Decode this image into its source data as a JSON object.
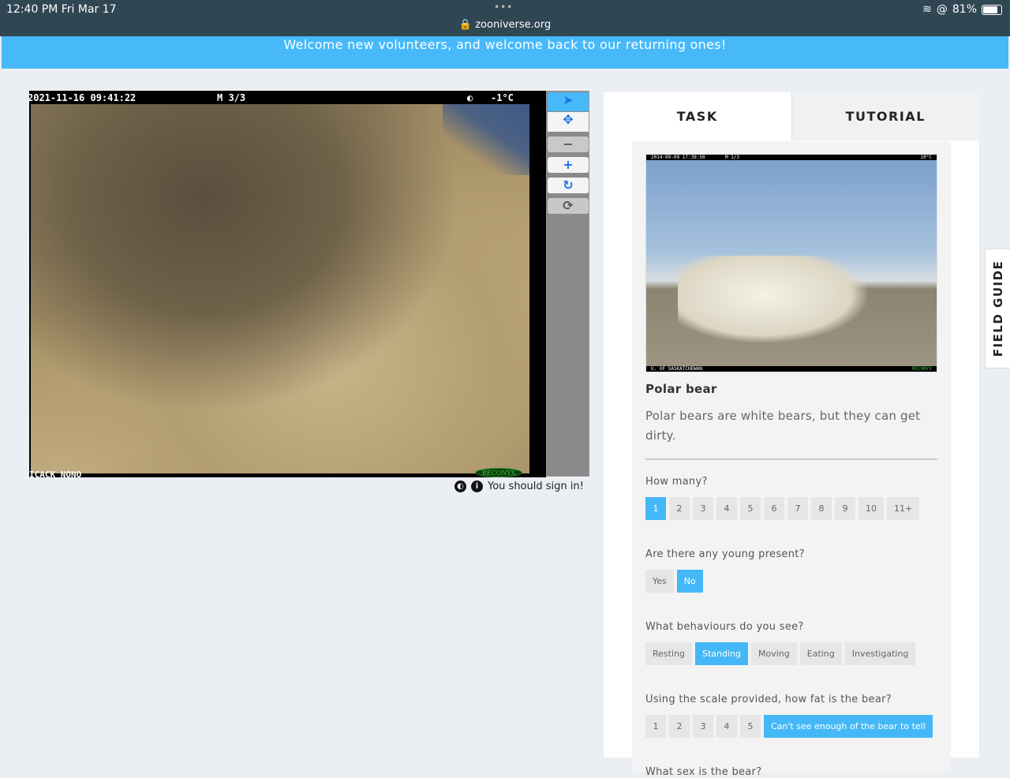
{
  "status": {
    "time": "12:40 PM  Fri Mar 17",
    "dots": "•••",
    "url": "zooniverse.org",
    "battery": "81%"
  },
  "banner": "Welcome new volunteers, and welcome back to our returning ones!",
  "viewer": {
    "timestamp": "2021-11-16 09:41:22",
    "frame": "M 3/3",
    "temp": "-1°C",
    "footer": "ICACK NONO",
    "brand": "RECONYX"
  },
  "signin": "You should sign in!",
  "tabs": {
    "task": "TASK",
    "tutorial": "TUTORIAL"
  },
  "field_guide": "FIELD GUIDE",
  "reference": {
    "timestamp": "2014-09-09 17:39:50",
    "frame": "M 1/3",
    "temp": "10°C",
    "footer": "U. OF SASKATCHEWAN",
    "brand": "RECONYX",
    "title": "Polar bear",
    "description": "Polar bears are white bears, but they can get dirty."
  },
  "questions": [
    {
      "label": "How many?",
      "options": [
        "1",
        "2",
        "3",
        "4",
        "5",
        "6",
        "7",
        "8",
        "9",
        "10",
        "11+"
      ],
      "selected": [
        0
      ]
    },
    {
      "label": "Are there any young present?",
      "options": [
        "Yes",
        "No"
      ],
      "selected": [
        1
      ]
    },
    {
      "label": "What behaviours do you see?",
      "options": [
        "Resting",
        "Standing",
        "Moving",
        "Eating",
        "Investigating"
      ],
      "selected": [
        1
      ]
    },
    {
      "label": "Using the scale provided, how fat is the bear?",
      "options": [
        "1",
        "2",
        "3",
        "4",
        "5",
        "Can't see enough of the bear to tell"
      ],
      "selected": [
        5
      ]
    },
    {
      "label": "What sex is the bear?",
      "options": [],
      "selected": []
    }
  ]
}
